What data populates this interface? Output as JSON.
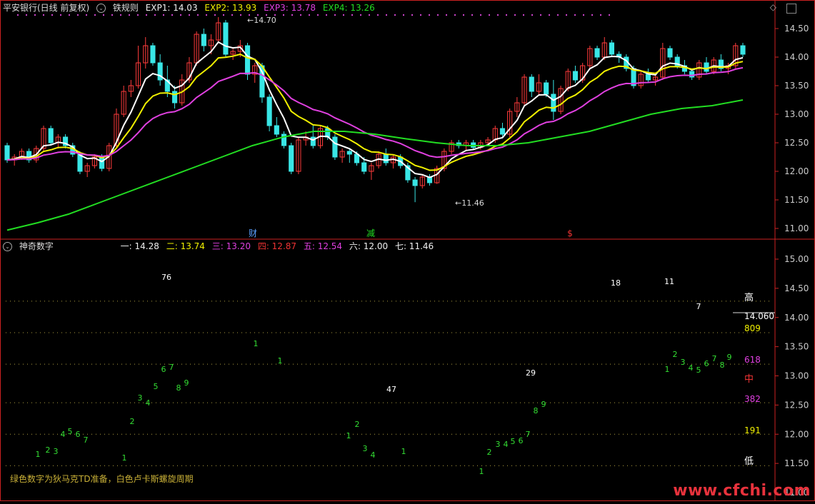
{
  "upper": {
    "title": "平安银行(日线 前复权)",
    "indicator": "铁规则",
    "exp1": "EXP1: 14.03",
    "exp2": "EXP2: 13.93",
    "exp3": "EXP3: 13.78",
    "exp4": "EXP4: 13.26",
    "high_label": "14.70",
    "low_label": "11.46",
    "y_ticks": [
      "14.50",
      "14.00",
      "13.50",
      "13.00",
      "12.50",
      "12.00",
      "11.50",
      "11.00"
    ],
    "events": [
      {
        "text": "财",
        "color": "#5aa0ff"
      },
      {
        "text": "减",
        "color": "#22dd22"
      },
      {
        "text": "$",
        "color": "#ee3333"
      }
    ]
  },
  "lower": {
    "indicator": "神奇数字",
    "l1": "一: 14.28",
    "l2": "二: 13.74",
    "l3": "三: 13.20",
    "l4": "四: 12.87",
    "l5": "五: 12.54",
    "l6": "六: 12.00",
    "l7": "七: 11.46",
    "y_ticks": [
      "15.00",
      "14.50",
      "14.00",
      "13.50",
      "13.00",
      "12.50",
      "12.00",
      "11.50",
      "11.00"
    ],
    "labels": [
      {
        "text": "高",
        "color": "#ffffff"
      },
      {
        "text": "14.060",
        "color": "#ffffff"
      },
      {
        "text": "809",
        "color": "#f0f000"
      },
      {
        "text": "618",
        "color": "#e040e0"
      },
      {
        "text": "中",
        "color": "#ee3333"
      },
      {
        "text": "382",
        "color": "#e040e0"
      },
      {
        "text": "191",
        "color": "#f0f000"
      },
      {
        "text": "低",
        "color": "#ffffff"
      }
    ],
    "lucas": [
      "76",
      "18",
      "11",
      "7",
      "47",
      "29"
    ],
    "note": "绿色数字为狄马克TD准备，白色卢卡斯螺旋周期"
  },
  "watermark": "www.cfchi.com",
  "colors": {
    "up": "#ff3b3b",
    "down": "#39e6e6",
    "ema1": "#ffffff",
    "ema2": "#f0f000",
    "ema3": "#e040e0",
    "ema4": "#22dd22",
    "dot": "#b0a040",
    "td": "#33dd33",
    "axis": "#cc2222"
  },
  "chart_data": {
    "type": "candlestick",
    "ohlc": [
      [
        12.45,
        12.5,
        12.15,
        12.2
      ],
      [
        12.2,
        12.3,
        12.1,
        12.25
      ],
      [
        12.25,
        12.4,
        12.2,
        12.35
      ],
      [
        12.35,
        12.4,
        12.15,
        12.2
      ],
      [
        12.2,
        12.45,
        12.15,
        12.4
      ],
      [
        12.4,
        12.8,
        12.35,
        12.75
      ],
      [
        12.75,
        12.8,
        12.45,
        12.5
      ],
      [
        12.5,
        12.65,
        12.4,
        12.6
      ],
      [
        12.6,
        12.65,
        12.4,
        12.45
      ],
      [
        12.45,
        12.5,
        12.25,
        12.3
      ],
      [
        12.3,
        12.35,
        11.95,
        12.0
      ],
      [
        12.0,
        12.15,
        11.9,
        12.1
      ],
      [
        12.1,
        12.3,
        12.05,
        12.25
      ],
      [
        12.25,
        12.3,
        12.0,
        12.05
      ],
      [
        12.05,
        12.5,
        12.0,
        12.45
      ],
      [
        12.45,
        13.1,
        12.4,
        13.0
      ],
      [
        13.0,
        13.5,
        12.95,
        13.4
      ],
      [
        13.4,
        13.6,
        13.3,
        13.5
      ],
      [
        13.5,
        14.2,
        13.45,
        13.9
      ],
      [
        13.9,
        14.35,
        13.8,
        14.2
      ],
      [
        14.2,
        14.25,
        13.85,
        13.9
      ],
      [
        13.9,
        14.05,
        13.5,
        13.6
      ],
      [
        13.6,
        13.85,
        13.3,
        13.4
      ],
      [
        13.4,
        13.5,
        13.1,
        13.2
      ],
      [
        13.2,
        13.7,
        13.15,
        13.6
      ],
      [
        13.6,
        14.0,
        13.55,
        13.9
      ],
      [
        13.9,
        14.45,
        13.85,
        14.4
      ],
      [
        14.4,
        14.5,
        14.1,
        14.2
      ],
      [
        14.2,
        14.4,
        14.05,
        14.3
      ],
      [
        14.3,
        14.7,
        14.25,
        14.6
      ],
      [
        14.6,
        14.65,
        14.0,
        14.05
      ],
      [
        14.05,
        14.15,
        13.95,
        14.1
      ],
      [
        14.1,
        14.3,
        14.0,
        14.2
      ],
      [
        14.2,
        14.25,
        13.6,
        13.7
      ],
      [
        13.7,
        13.9,
        13.55,
        13.85
      ],
      [
        13.85,
        13.9,
        13.2,
        13.3
      ],
      [
        13.3,
        13.35,
        12.7,
        12.8
      ],
      [
        12.8,
        12.95,
        12.6,
        12.65
      ],
      [
        12.65,
        12.7,
        12.4,
        12.45
      ],
      [
        12.45,
        12.5,
        11.95,
        12.0
      ],
      [
        12.0,
        12.6,
        11.95,
        12.55
      ],
      [
        12.55,
        12.7,
        12.45,
        12.6
      ],
      [
        12.6,
        12.8,
        12.4,
        12.45
      ],
      [
        12.45,
        12.8,
        12.4,
        12.75
      ],
      [
        12.75,
        12.8,
        12.55,
        12.6
      ],
      [
        12.6,
        12.65,
        12.2,
        12.25
      ],
      [
        12.25,
        12.4,
        12.15,
        12.35
      ],
      [
        12.35,
        12.4,
        12.15,
        12.3
      ],
      [
        12.3,
        12.35,
        12.1,
        12.15
      ],
      [
        12.15,
        12.25,
        11.95,
        12.0
      ],
      [
        12.0,
        12.15,
        11.85,
        12.1
      ],
      [
        12.1,
        12.35,
        12.05,
        12.3
      ],
      [
        12.3,
        12.4,
        12.1,
        12.15
      ],
      [
        12.15,
        12.3,
        12.05,
        12.25
      ],
      [
        12.25,
        12.3,
        12.05,
        12.1
      ],
      [
        12.1,
        12.15,
        11.8,
        11.85
      ],
      [
        11.85,
        11.9,
        11.46,
        11.75
      ],
      [
        11.75,
        11.95,
        11.7,
        11.9
      ],
      [
        11.9,
        11.95,
        11.75,
        11.8
      ],
      [
        11.8,
        12.1,
        11.78,
        12.05
      ],
      [
        12.05,
        12.4,
        12.0,
        12.35
      ],
      [
        12.35,
        12.55,
        12.3,
        12.5
      ],
      [
        12.5,
        12.55,
        12.4,
        12.45
      ],
      [
        12.45,
        12.55,
        12.35,
        12.5
      ],
      [
        12.5,
        12.55,
        12.38,
        12.42
      ],
      [
        12.42,
        12.55,
        12.38,
        12.5
      ],
      [
        12.5,
        12.6,
        12.45,
        12.55
      ],
      [
        12.55,
        12.8,
        12.5,
        12.75
      ],
      [
        12.75,
        12.85,
        12.6,
        12.65
      ],
      [
        12.65,
        13.1,
        12.6,
        13.05
      ],
      [
        13.05,
        13.3,
        12.95,
        13.2
      ],
      [
        13.2,
        13.7,
        13.15,
        13.65
      ],
      [
        13.65,
        13.7,
        13.3,
        13.4
      ],
      [
        13.4,
        13.7,
        13.35,
        13.55
      ],
      [
        13.55,
        13.6,
        13.3,
        13.35
      ],
      [
        13.35,
        13.6,
        12.9,
        13.05
      ],
      [
        13.05,
        13.5,
        13.0,
        13.45
      ],
      [
        13.45,
        13.8,
        13.4,
        13.75
      ],
      [
        13.75,
        13.85,
        13.55,
        13.6
      ],
      [
        13.6,
        13.9,
        13.55,
        13.85
      ],
      [
        13.85,
        14.2,
        13.8,
        14.15
      ],
      [
        14.15,
        14.2,
        13.95,
        14.0
      ],
      [
        14.0,
        14.35,
        13.95,
        14.25
      ],
      [
        14.25,
        14.3,
        14.0,
        14.05
      ],
      [
        14.05,
        14.1,
        13.9,
        14.0
      ],
      [
        14.0,
        14.05,
        13.75,
        13.8
      ],
      [
        13.8,
        13.85,
        13.45,
        13.5
      ],
      [
        13.5,
        13.75,
        13.45,
        13.7
      ],
      [
        13.7,
        13.8,
        13.55,
        13.6
      ],
      [
        13.6,
        13.7,
        13.5,
        13.65
      ],
      [
        13.65,
        14.25,
        13.6,
        14.15
      ],
      [
        14.15,
        14.2,
        13.95,
        14.0
      ],
      [
        14.0,
        14.05,
        13.8,
        13.85
      ],
      [
        13.85,
        13.95,
        13.7,
        13.75
      ],
      [
        13.75,
        13.8,
        13.6,
        13.65
      ],
      [
        13.65,
        13.95,
        13.6,
        13.9
      ],
      [
        13.9,
        14.0,
        13.7,
        13.75
      ],
      [
        13.75,
        14.0,
        13.7,
        13.95
      ],
      [
        13.95,
        14.05,
        13.75,
        13.8
      ],
      [
        13.8,
        13.9,
        13.7,
        13.85
      ],
      [
        13.85,
        14.25,
        13.8,
        14.2
      ],
      [
        14.2,
        14.25,
        14.0,
        14.05
      ]
    ],
    "td_sequence": [
      1,
      2,
      3,
      4,
      5,
      6,
      7,
      1,
      2,
      3,
      4,
      5,
      6,
      7,
      8,
      9,
      1,
      1,
      1,
      2,
      3,
      4,
      1,
      1,
      2,
      3,
      4,
      5,
      6,
      7,
      8,
      9,
      1,
      2,
      3,
      4,
      5,
      6,
      7,
      8,
      9
    ]
  }
}
